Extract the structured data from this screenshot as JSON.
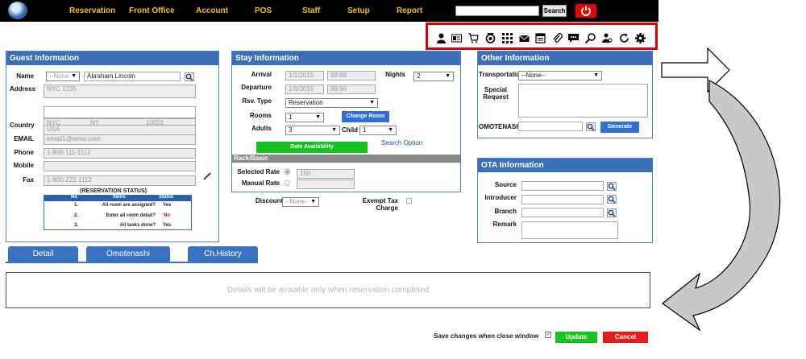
{
  "nav": {
    "items": [
      "Reservation",
      "Front Office",
      "Account",
      "POS",
      "Staff",
      "Setup",
      "Report"
    ],
    "search_button": "Search"
  },
  "toolbar": {
    "icons": [
      "guest-icon",
      "id-card-icon",
      "cart-icon",
      "settings-icon",
      "grid-icon",
      "mail-icon",
      "calendar-icon",
      "attachment-icon",
      "chat-icon",
      "search-icon",
      "user-search-icon",
      "refresh-icon",
      "gear-icon"
    ]
  },
  "guest": {
    "title": "Guest Information",
    "name_label": "Name",
    "title_select": "--None",
    "name_value": "Abraham Lincoln",
    "address_label": "Address",
    "address_value": "NYC 1235",
    "city": "NYC",
    "state": "NY",
    "zip": "10001",
    "country_label": "Country",
    "country_value": "USA",
    "email_label": "EMAIL",
    "email_value": "email1@emai.com",
    "phone_label": "Phone",
    "phone_value": "1-800-111-1112",
    "mobile_label": "Mobile",
    "mobile_value": "",
    "fax_label": "Fax",
    "fax_value": "1-800-222-1112",
    "status_title": "(RESERVATION STATUS)",
    "status_headers": [
      "No",
      "Items",
      "Status"
    ],
    "status_rows": [
      {
        "no": "1.",
        "item": "All room are assigned?",
        "status": "Yes",
        "color": "#000000"
      },
      {
        "no": "2.",
        "item": "Enter all room detail?",
        "status": "No",
        "color": "#e00000"
      },
      {
        "no": "3.",
        "item": "All tasks done?",
        "status": "Yes",
        "color": "#000000"
      }
    ]
  },
  "stay": {
    "title": "Stay Information",
    "arrival_label": "Arrival",
    "arrival_date": "1/1/2015",
    "arrival_time": "99:99",
    "nights_label": "Nights",
    "nights_value": "2",
    "departure_label": "Departure",
    "departure_date": "1/3/2015",
    "departure_time": "99:99",
    "rsv_type_label": "Rsv. Type",
    "rsv_type_value": "Reservation",
    "rooms_label": "Rooms",
    "rooms_value": "1",
    "change_room_button": "Change Room",
    "adults_label": "Adults",
    "adults_value": "3",
    "child_label": "Child",
    "child_value": "1",
    "rate_availability_button": "Rate Availability",
    "search_option_link": "Search Option",
    "rack_header": "Rack/Basic",
    "selected_rate_label": "Selected Rate",
    "selected_rate_value": "150",
    "manual_rate_label": "Manual Rate",
    "manual_rate_value": "",
    "discount_label": "Discount",
    "discount_value": "--None--",
    "exempt_label": "Exempt Tax Charge"
  },
  "other": {
    "title": "Other Information",
    "transportation_label": "Transportation",
    "transportation_value": "--None--",
    "special_request_label_1": "Special",
    "special_request_label_2": "Request",
    "omotenashi_label": "OMOTENASHI",
    "generate_button": "Generate"
  },
  "ota": {
    "title": "OTA Information",
    "source_label": "Source",
    "introducer_label": "Introducer",
    "branch_label": "Branch",
    "remark_label": "Remark"
  },
  "tabs": [
    "Detail",
    "Omotenashi",
    "Ch.History"
  ],
  "details_message": "Details will be avaiable only when reservation completed",
  "footer": {
    "save_label": "Save changes when close window",
    "update_button": "Update",
    "cancel_button": "Cancel"
  },
  "colors": {
    "accent_blue": "#3b6fb8",
    "nav_text": "#f2c200",
    "highlight_red": "#e00000"
  }
}
